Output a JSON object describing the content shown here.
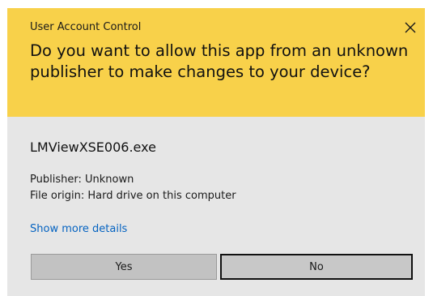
{
  "dialog": {
    "caption": "User Account Control",
    "question": "Do you want to allow this app from an unknown publisher to make changes to your device?",
    "app_name": "LMViewXSE006.exe",
    "publisher": "Publisher: Unknown",
    "file_origin": "File origin: Hard drive on this computer",
    "details_link": "Show more details",
    "buttons": {
      "yes": "Yes",
      "no": "No"
    },
    "icons": {
      "close": "close-icon"
    },
    "colors": {
      "header_bg": "#f8d14a",
      "body_bg": "#e6e6e6",
      "link": "#0563c1"
    }
  }
}
